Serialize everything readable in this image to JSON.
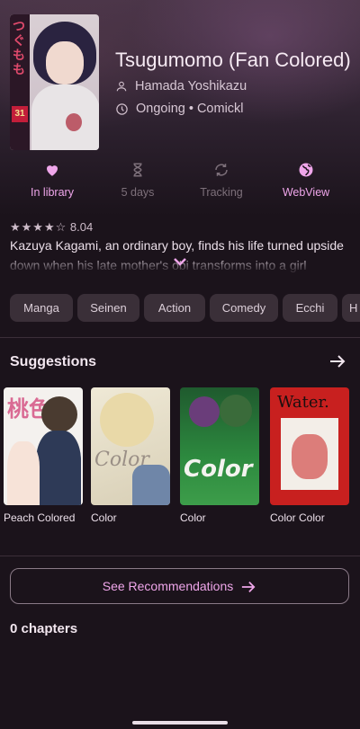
{
  "manga": {
    "title": "Tsugumomo (Fan Colored)",
    "author": "Hamada Yoshikazu",
    "status_line": "Ongoing • Comickl",
    "cover": {
      "spine_text": "つぐもも",
      "volume": "31"
    }
  },
  "actions": [
    {
      "label": "In library",
      "icon": "heart-icon",
      "active": true
    },
    {
      "label": "5 days",
      "icon": "hourglass-icon",
      "active": false
    },
    {
      "label": "Tracking",
      "icon": "sync-icon",
      "active": false
    },
    {
      "label": "WebView",
      "icon": "globe-icon",
      "active": true
    }
  ],
  "rating": {
    "stars": "★★★★☆",
    "value": "8.04"
  },
  "description": "Kazuya Kagami, an ordinary boy, finds his life turned upside down when his late mother's obi transforms into a girl",
  "genres": [
    "Manga",
    "Seinen",
    "Action",
    "Comedy",
    "Ecchi",
    "H"
  ],
  "suggestions": {
    "title": "Suggestions",
    "items": [
      {
        "caption": "Peach Colored",
        "cover_text": "桃色"
      },
      {
        "caption": "Color",
        "cover_text": "Color"
      },
      {
        "caption": "Color",
        "cover_text": "Color"
      },
      {
        "caption": "Color Color",
        "cover_text": "Water."
      }
    ]
  },
  "recommendations_button": "See Recommendations",
  "chapters_count": "0 chapters",
  "colors": {
    "accent": "#efa6ea",
    "background": "#1b131b",
    "chip": "#3a2f38"
  }
}
